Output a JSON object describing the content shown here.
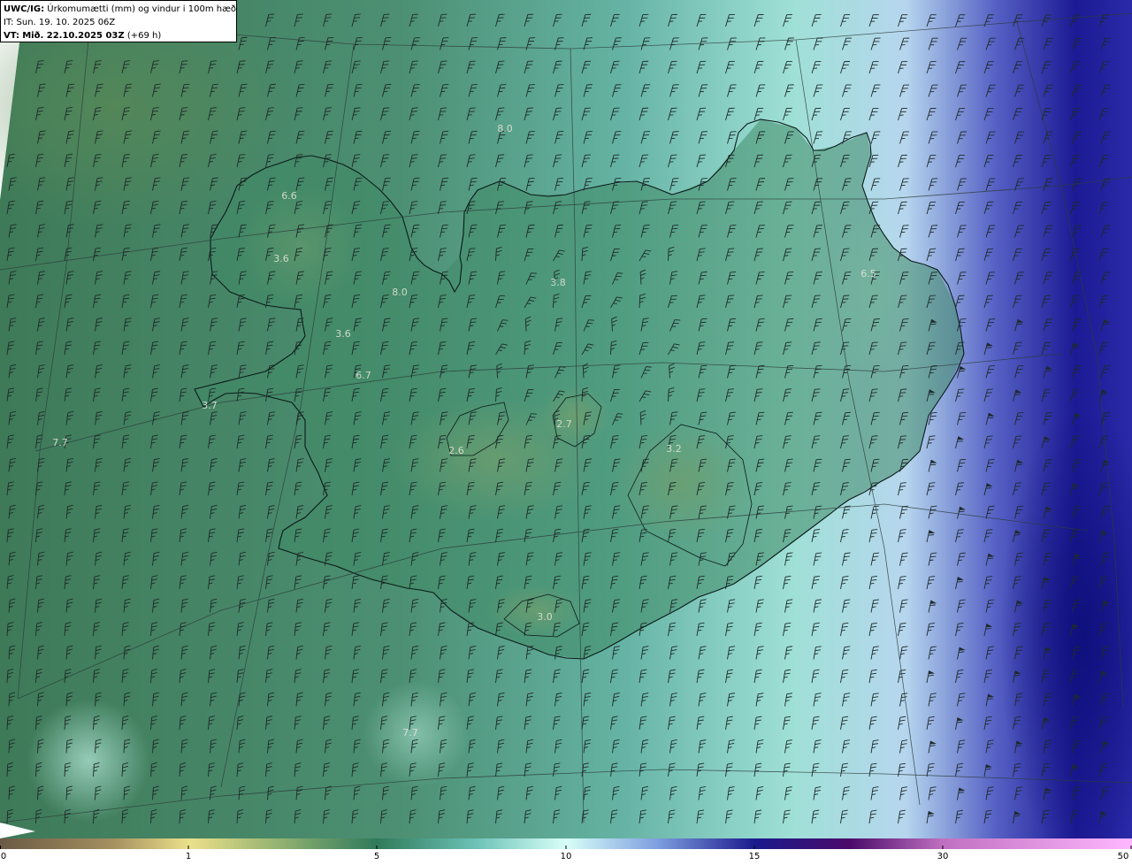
{
  "header": {
    "product": "UWC/IG:",
    "title": "Úrkomumætti (mm) og vindur i 100m hæð",
    "it_label": "IT:",
    "it_value": "Sun. 19. 10. 2025 06Z",
    "vt_label": "VT:",
    "vt_value": "Mið. 22.10.2025 03Z",
    "vt_offset": "(+69 h)"
  },
  "colorbar": {
    "ticks": [
      "0",
      "1",
      "5",
      "10",
      "15",
      "30",
      "50"
    ],
    "colors": [
      "#6b5a44",
      "#b9a66a",
      "#ece08a",
      "#6f9a6a",
      "#2f7a5a",
      "#6cc2b6",
      "#d8fff8",
      "#7f9fe0",
      "#1a1a8c",
      "#4a0a6a",
      "#c070c0",
      "#ffb8ff"
    ]
  },
  "map_labels": [
    {
      "text": "8.0"
    },
    {
      "text": "6.6"
    },
    {
      "text": "3.6"
    },
    {
      "text": "8.0"
    },
    {
      "text": "3.6"
    },
    {
      "text": "6.7"
    },
    {
      "text": "3.7"
    },
    {
      "text": "7.7"
    },
    {
      "text": "3.8"
    },
    {
      "text": "2.7"
    },
    {
      "text": "2.6"
    },
    {
      "text": "3.2"
    },
    {
      "text": "6.5"
    },
    {
      "text": "3.0"
    },
    {
      "text": "7.7"
    }
  ],
  "wind_field": {
    "units": "knots",
    "dominant_direction": "south-southwest",
    "barb_type": "wind-barb"
  }
}
